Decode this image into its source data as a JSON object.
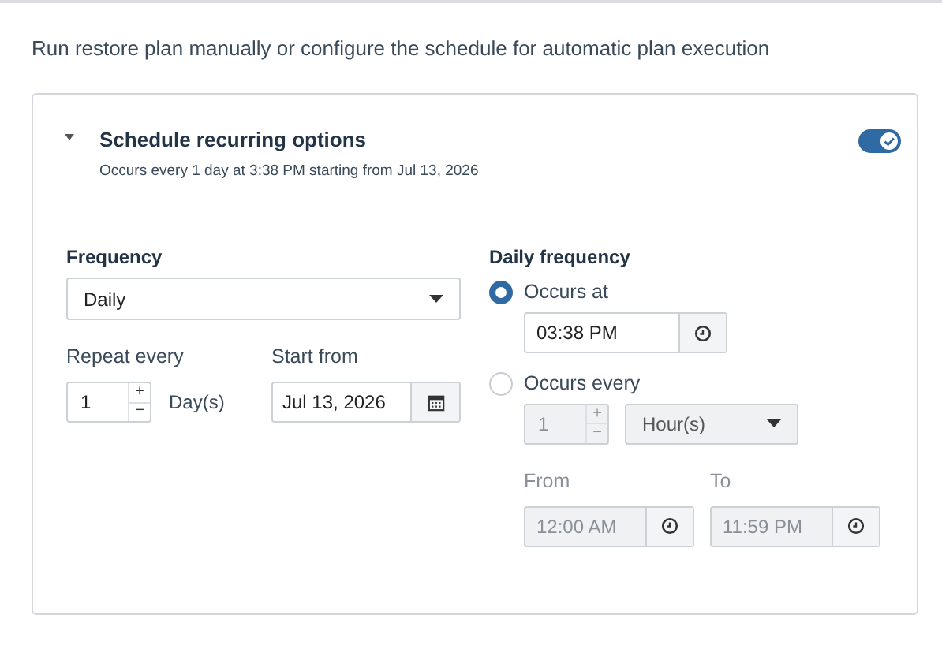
{
  "description": "Run restore plan manually or configure the schedule for automatic plan execution",
  "schedule": {
    "title": "Schedule recurring options",
    "summary": "Occurs every 1 day at 3:38 PM starting from Jul 13, 2026",
    "expanded": true,
    "on": true
  },
  "frequency": {
    "label": "Frequency",
    "value": "Daily"
  },
  "repeat": {
    "label": "Repeat every",
    "value": "1",
    "plus": "+",
    "minus": "−",
    "unit": "Day(s)"
  },
  "start": {
    "label": "Start from",
    "value": "Jul 13, 2026"
  },
  "daily": {
    "label": "Daily frequency",
    "options": [
      {
        "label": "Occurs at",
        "selected": true
      },
      {
        "label": "Occurs every",
        "selected": false
      }
    ],
    "time": "03:38 PM",
    "every": {
      "value": "1",
      "plus": "+",
      "minus": "−",
      "unit": "Hour(s)",
      "disabled": true
    },
    "from": {
      "label": "From",
      "value": "12:00 AM",
      "disabled": true
    },
    "to": {
      "label": "To",
      "value": "11:59 PM",
      "disabled": true
    }
  }
}
